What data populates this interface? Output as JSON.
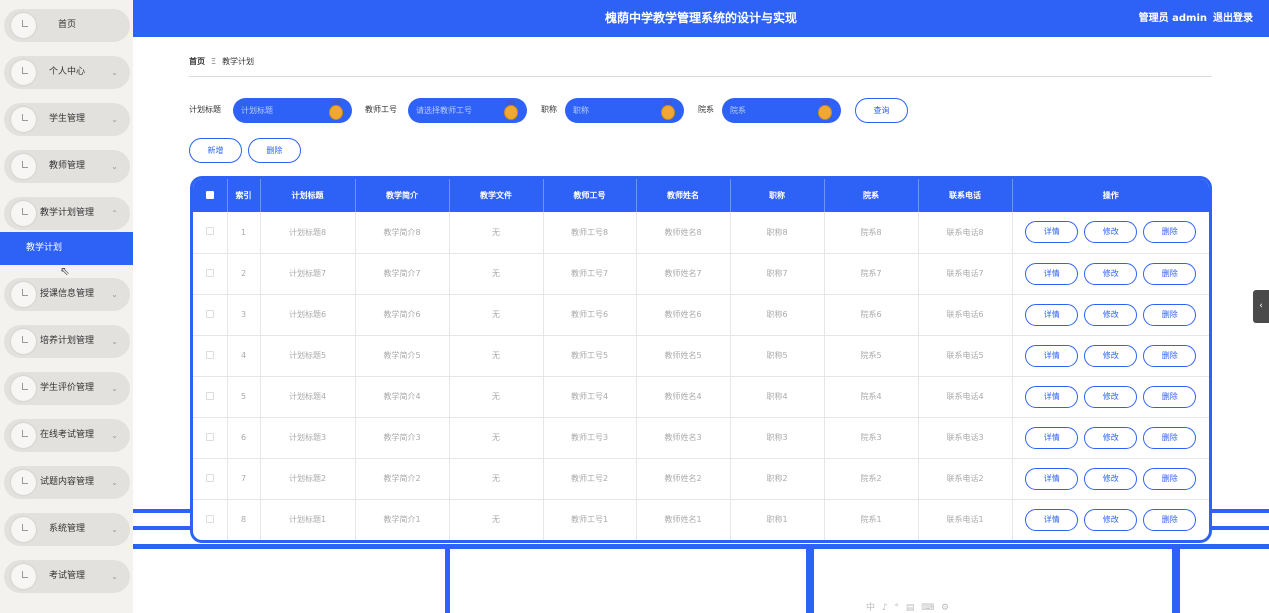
{
  "header": {
    "title": "槐荫中学教学管理系统的设计与实现",
    "admin": "管理员 admin",
    "logout": "退出登录"
  },
  "sidebar": {
    "items": [
      {
        "label": "首页",
        "chevron": ""
      },
      {
        "label": "个人中心",
        "chevron": "⌄"
      },
      {
        "label": "学生管理",
        "chevron": "⌄"
      },
      {
        "label": "教师管理",
        "chevron": "⌄"
      },
      {
        "label": "教学计划管理",
        "chevron": "⌃"
      },
      {
        "label": "授课信息管理",
        "chevron": "⌄"
      },
      {
        "label": "培养计划管理",
        "chevron": "⌄"
      },
      {
        "label": "学生评价管理",
        "chevron": "⌄"
      },
      {
        "label": "在线考试管理",
        "chevron": "⌄"
      },
      {
        "label": "试题内容管理",
        "chevron": "⌄"
      },
      {
        "label": "系统管理",
        "chevron": "⌄"
      },
      {
        "label": "考试管理",
        "chevron": "⌄"
      }
    ],
    "active_sub": "教学计划"
  },
  "breadcrumb": {
    "home": "首页",
    "sep": "Ξ",
    "current": "教学计划"
  },
  "search": {
    "fields": [
      {
        "label": "计划标题",
        "placeholder": "计划标题"
      },
      {
        "label": "教师工号",
        "placeholder": "请选择教师工号"
      },
      {
        "label": "职称",
        "placeholder": "职称"
      },
      {
        "label": "院系",
        "placeholder": "院系"
      }
    ],
    "query_button": "查询"
  },
  "actions": {
    "add": "新增",
    "delete": "删除"
  },
  "table": {
    "headers": [
      "索引",
      "计划标题",
      "教学简介",
      "教学文件",
      "教师工号",
      "教师姓名",
      "职称",
      "院系",
      "联系电话",
      "操作"
    ],
    "rows": [
      [
        "1",
        "计划标题8",
        "教学简介8",
        "无",
        "教师工号8",
        "教师姓名8",
        "职称8",
        "院系8",
        "联系电话8"
      ],
      [
        "2",
        "计划标题7",
        "教学简介7",
        "无",
        "教师工号7",
        "教师姓名7",
        "职称7",
        "院系7",
        "联系电话7"
      ],
      [
        "3",
        "计划标题6",
        "教学简介6",
        "无",
        "教师工号6",
        "教师姓名6",
        "职称6",
        "院系6",
        "联系电话6"
      ],
      [
        "4",
        "计划标题5",
        "教学简介5",
        "无",
        "教师工号5",
        "教师姓名5",
        "职称5",
        "院系5",
        "联系电话5"
      ],
      [
        "5",
        "计划标题4",
        "教学简介4",
        "无",
        "教师工号4",
        "教师姓名4",
        "职称4",
        "院系4",
        "联系电话4"
      ],
      [
        "6",
        "计划标题3",
        "教学简介3",
        "无",
        "教师工号3",
        "教师姓名3",
        "职称3",
        "院系3",
        "联系电话3"
      ],
      [
        "7",
        "计划标题2",
        "教学简介2",
        "无",
        "教师工号2",
        "教师姓名2",
        "职称2",
        "院系2",
        "联系电话2"
      ],
      [
        "8",
        "计划标题1",
        "教学简介1",
        "无",
        "教师工号1",
        "教师姓名1",
        "职称1",
        "院系1",
        "联系电话1"
      ]
    ],
    "row_buttons": {
      "detail": "详情",
      "edit": "修改",
      "delete": "删除"
    }
  },
  "edge_tab": "‹",
  "ime_bar": "中 ♪ ° ▤ ⌨ ⚙",
  "colors": {
    "primary": "#2e62f6",
    "sidebar_bg": "#f4f2ee",
    "pill_bg": "#e3e1de",
    "medal": "#f0a833"
  }
}
